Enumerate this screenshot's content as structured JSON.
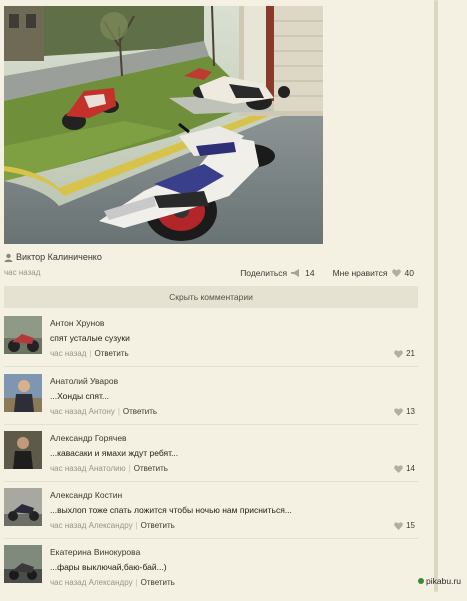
{
  "post": {
    "author": "Виктор Калиниченко",
    "time": "час назад",
    "share_label": "Поделиться",
    "share_count": "14",
    "like_label": "Мне нравится",
    "like_count": "40",
    "hide_comments_label": "Скрыть комментарии"
  },
  "comments": [
    {
      "name": "Антон Хрунов",
      "text": "спят усталые сузуки",
      "time": "час назад",
      "reply": "Ответить",
      "likes": "21"
    },
    {
      "name": "Анатолий Уваров",
      "text": "...Хонды спят...",
      "time": "час назад Антону",
      "reply": "Ответить",
      "likes": "13"
    },
    {
      "name": "Александр Горячев",
      "text": "...кавасаки и ямахи ждут ребят...",
      "time": "час назад Анатолию",
      "reply": "Ответить",
      "likes": "14"
    },
    {
      "name": "Александр Костин",
      "text": "...выхлоп тоже спать ложится чтобы ночью нам присниться...",
      "time": "час назад Александру",
      "reply": "Ответить",
      "likes": "15"
    },
    {
      "name": "Екатерина Винокурова",
      "text": "...фары выключай,баю-бай...)",
      "time": "час назад Александру",
      "reply": "Ответить",
      "likes": ""
    }
  ],
  "watermark": "pikabu.ru",
  "icons": {
    "author": "user-icon",
    "share": "megaphone-icon",
    "like": "heart-icon"
  }
}
